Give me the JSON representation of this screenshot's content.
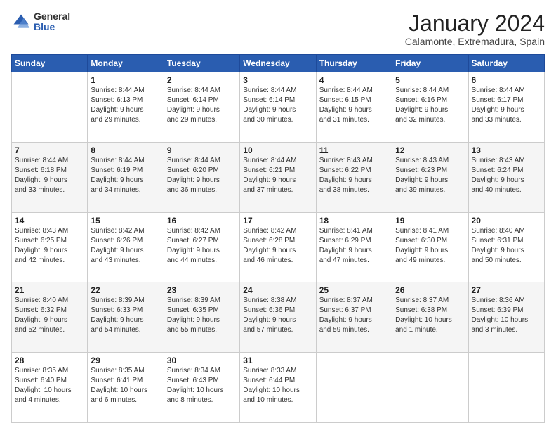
{
  "logo": {
    "general": "General",
    "blue": "Blue"
  },
  "title": "January 2024",
  "subtitle": "Calamonte, Extremadura, Spain",
  "headers": [
    "Sunday",
    "Monday",
    "Tuesday",
    "Wednesday",
    "Thursday",
    "Friday",
    "Saturday"
  ],
  "weeks": [
    {
      "shaded": false,
      "days": [
        {
          "num": "",
          "info": ""
        },
        {
          "num": "1",
          "info": "Sunrise: 8:44 AM\nSunset: 6:13 PM\nDaylight: 9 hours\nand 29 minutes."
        },
        {
          "num": "2",
          "info": "Sunrise: 8:44 AM\nSunset: 6:14 PM\nDaylight: 9 hours\nand 29 minutes."
        },
        {
          "num": "3",
          "info": "Sunrise: 8:44 AM\nSunset: 6:14 PM\nDaylight: 9 hours\nand 30 minutes."
        },
        {
          "num": "4",
          "info": "Sunrise: 8:44 AM\nSunset: 6:15 PM\nDaylight: 9 hours\nand 31 minutes."
        },
        {
          "num": "5",
          "info": "Sunrise: 8:44 AM\nSunset: 6:16 PM\nDaylight: 9 hours\nand 32 minutes."
        },
        {
          "num": "6",
          "info": "Sunrise: 8:44 AM\nSunset: 6:17 PM\nDaylight: 9 hours\nand 33 minutes."
        }
      ]
    },
    {
      "shaded": true,
      "days": [
        {
          "num": "7",
          "info": "Sunrise: 8:44 AM\nSunset: 6:18 PM\nDaylight: 9 hours\nand 33 minutes."
        },
        {
          "num": "8",
          "info": "Sunrise: 8:44 AM\nSunset: 6:19 PM\nDaylight: 9 hours\nand 34 minutes."
        },
        {
          "num": "9",
          "info": "Sunrise: 8:44 AM\nSunset: 6:20 PM\nDaylight: 9 hours\nand 36 minutes."
        },
        {
          "num": "10",
          "info": "Sunrise: 8:44 AM\nSunset: 6:21 PM\nDaylight: 9 hours\nand 37 minutes."
        },
        {
          "num": "11",
          "info": "Sunrise: 8:43 AM\nSunset: 6:22 PM\nDaylight: 9 hours\nand 38 minutes."
        },
        {
          "num": "12",
          "info": "Sunrise: 8:43 AM\nSunset: 6:23 PM\nDaylight: 9 hours\nand 39 minutes."
        },
        {
          "num": "13",
          "info": "Sunrise: 8:43 AM\nSunset: 6:24 PM\nDaylight: 9 hours\nand 40 minutes."
        }
      ]
    },
    {
      "shaded": false,
      "days": [
        {
          "num": "14",
          "info": "Sunrise: 8:43 AM\nSunset: 6:25 PM\nDaylight: 9 hours\nand 42 minutes."
        },
        {
          "num": "15",
          "info": "Sunrise: 8:42 AM\nSunset: 6:26 PM\nDaylight: 9 hours\nand 43 minutes."
        },
        {
          "num": "16",
          "info": "Sunrise: 8:42 AM\nSunset: 6:27 PM\nDaylight: 9 hours\nand 44 minutes."
        },
        {
          "num": "17",
          "info": "Sunrise: 8:42 AM\nSunset: 6:28 PM\nDaylight: 9 hours\nand 46 minutes."
        },
        {
          "num": "18",
          "info": "Sunrise: 8:41 AM\nSunset: 6:29 PM\nDaylight: 9 hours\nand 47 minutes."
        },
        {
          "num": "19",
          "info": "Sunrise: 8:41 AM\nSunset: 6:30 PM\nDaylight: 9 hours\nand 49 minutes."
        },
        {
          "num": "20",
          "info": "Sunrise: 8:40 AM\nSunset: 6:31 PM\nDaylight: 9 hours\nand 50 minutes."
        }
      ]
    },
    {
      "shaded": true,
      "days": [
        {
          "num": "21",
          "info": "Sunrise: 8:40 AM\nSunset: 6:32 PM\nDaylight: 9 hours\nand 52 minutes."
        },
        {
          "num": "22",
          "info": "Sunrise: 8:39 AM\nSunset: 6:33 PM\nDaylight: 9 hours\nand 54 minutes."
        },
        {
          "num": "23",
          "info": "Sunrise: 8:39 AM\nSunset: 6:35 PM\nDaylight: 9 hours\nand 55 minutes."
        },
        {
          "num": "24",
          "info": "Sunrise: 8:38 AM\nSunset: 6:36 PM\nDaylight: 9 hours\nand 57 minutes."
        },
        {
          "num": "25",
          "info": "Sunrise: 8:37 AM\nSunset: 6:37 PM\nDaylight: 9 hours\nand 59 minutes."
        },
        {
          "num": "26",
          "info": "Sunrise: 8:37 AM\nSunset: 6:38 PM\nDaylight: 10 hours\nand 1 minute."
        },
        {
          "num": "27",
          "info": "Sunrise: 8:36 AM\nSunset: 6:39 PM\nDaylight: 10 hours\nand 3 minutes."
        }
      ]
    },
    {
      "shaded": false,
      "days": [
        {
          "num": "28",
          "info": "Sunrise: 8:35 AM\nSunset: 6:40 PM\nDaylight: 10 hours\nand 4 minutes."
        },
        {
          "num": "29",
          "info": "Sunrise: 8:35 AM\nSunset: 6:41 PM\nDaylight: 10 hours\nand 6 minutes."
        },
        {
          "num": "30",
          "info": "Sunrise: 8:34 AM\nSunset: 6:43 PM\nDaylight: 10 hours\nand 8 minutes."
        },
        {
          "num": "31",
          "info": "Sunrise: 8:33 AM\nSunset: 6:44 PM\nDaylight: 10 hours\nand 10 minutes."
        },
        {
          "num": "",
          "info": ""
        },
        {
          "num": "",
          "info": ""
        },
        {
          "num": "",
          "info": ""
        }
      ]
    }
  ]
}
